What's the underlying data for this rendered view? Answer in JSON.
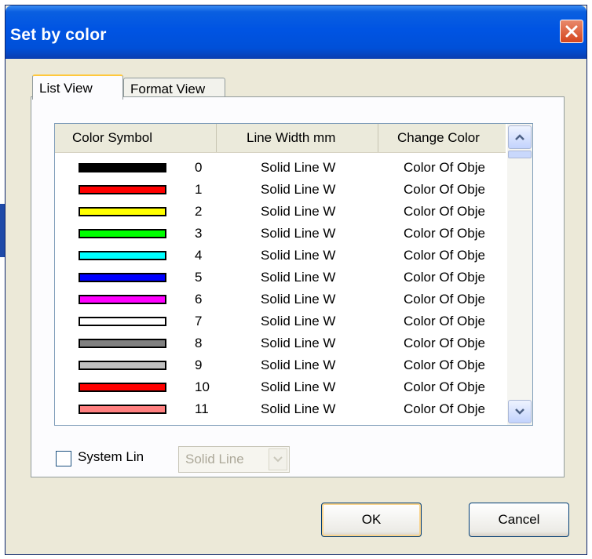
{
  "window": {
    "title": "Set by color"
  },
  "tabs": [
    {
      "label": "List View",
      "active": true
    },
    {
      "label": "Format View",
      "active": false
    }
  ],
  "table": {
    "columns": [
      "Color Symbol",
      "Line Width mm",
      "Change Color"
    ],
    "rows": [
      {
        "color": "#000000",
        "index": "0",
        "line_width": "Solid Line W",
        "change_color": "Color Of Obje"
      },
      {
        "color": "#ff0000",
        "index": "1",
        "line_width": "Solid Line W",
        "change_color": "Color Of Obje"
      },
      {
        "color": "#ffff00",
        "index": "2",
        "line_width": "Solid Line W",
        "change_color": "Color Of Obje"
      },
      {
        "color": "#00ff00",
        "index": "3",
        "line_width": "Solid Line W",
        "change_color": "Color Of Obje"
      },
      {
        "color": "#00ffff",
        "index": "4",
        "line_width": "Solid Line W",
        "change_color": "Color Of Obje"
      },
      {
        "color": "#0000ff",
        "index": "5",
        "line_width": "Solid Line W",
        "change_color": "Color Of Obje"
      },
      {
        "color": "#ff00ff",
        "index": "6",
        "line_width": "Solid Line W",
        "change_color": "Color Of Obje"
      },
      {
        "color": "#ffffff",
        "index": "7",
        "line_width": "Solid Line W",
        "change_color": "Color Of Obje"
      },
      {
        "color": "#808080",
        "index": "8",
        "line_width": "Solid Line W",
        "change_color": "Color Of Obje"
      },
      {
        "color": "#c0c0c0",
        "index": "9",
        "line_width": "Solid Line W",
        "change_color": "Color Of Obje"
      },
      {
        "color": "#ff0000",
        "index": "10",
        "line_width": "Solid Line W",
        "change_color": "Color Of Obje"
      },
      {
        "color": "#ff8080",
        "index": "11",
        "line_width": "Solid Line W",
        "change_color": "Color Of Obje"
      }
    ]
  },
  "system_line": {
    "label": "System Lin",
    "checked": false,
    "value": "Solid Line"
  },
  "buttons": {
    "ok": "OK",
    "cancel": "Cancel"
  },
  "icons": {
    "close": "close-icon",
    "scroll_up": "scroll-up-arrow-icon",
    "scroll_down": "scroll-down-arrow-icon",
    "dropdown": "chevron-down-icon"
  },
  "colors": {
    "titlebar": "#0054e3",
    "dialog_bg": "#ece9d8",
    "accent_tab": "#ffc83c"
  }
}
